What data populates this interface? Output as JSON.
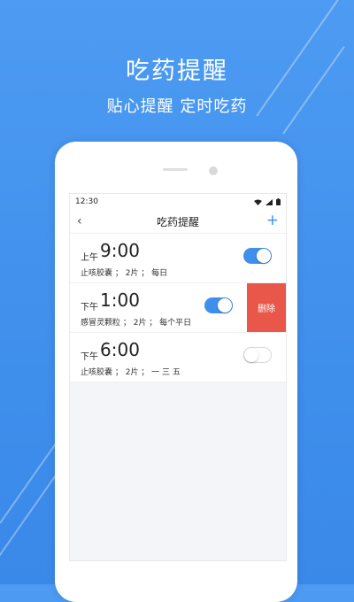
{
  "hero": {
    "title": "吃药提醒",
    "subtitle": "贴心提醒  定时吃药"
  },
  "status_bar": {
    "time": "12:30"
  },
  "nav": {
    "title": "吃药提醒",
    "back_icon": "‹",
    "add_icon": "+"
  },
  "reminders": [
    {
      "period": "上午",
      "time": "9:00",
      "detail": "止咳胶囊 ； 2片 ； 每日",
      "enabled": true
    },
    {
      "period": "下午",
      "time": "1:00",
      "detail": "感冒灵颗粒 ； 2片 ； 每个平日",
      "enabled": true,
      "swiped": true,
      "delete_label": "删除"
    },
    {
      "period": "下午",
      "time": "6:00",
      "detail": "止咳胶囊 ； 2片 ； 一 三 五",
      "enabled": false
    }
  ],
  "colors": {
    "accent": "#3f8fec",
    "background": "#4d9bf2",
    "delete": "#e9574a"
  }
}
